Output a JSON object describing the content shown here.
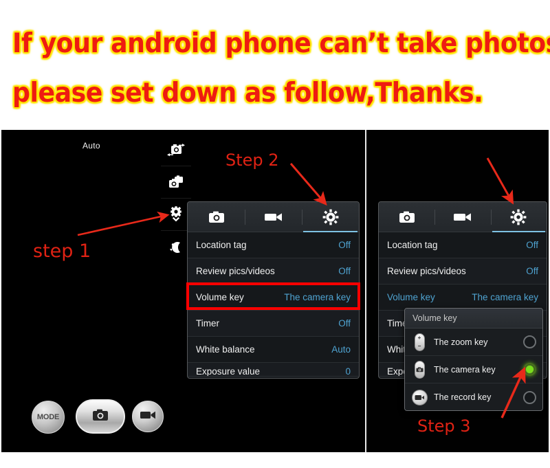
{
  "headline": {
    "line1": "If your android phone can’t take photos,",
    "line2": "please set down as follow,Thanks.",
    "text_color": "#ee1b11",
    "outline_color": "#ffe400"
  },
  "annotations": [
    {
      "id": "step-1",
      "label": "step 1",
      "color": "#e02214"
    },
    {
      "id": "step-2",
      "label": "Step 2",
      "color": "#e02214"
    },
    {
      "id": "step-3",
      "label": "Step 3",
      "color": "#e02214"
    }
  ],
  "viewfinder": {
    "mode_label": "Auto",
    "side_icons": [
      {
        "name": "switch-camera-icon"
      },
      {
        "name": "multi-shot-camera-icon"
      },
      {
        "name": "settings-gear-expand-icon"
      },
      {
        "name": "night-mode-icon"
      }
    ],
    "controls": {
      "mode_label": "MODE",
      "shutter_icon": "camera-icon",
      "record_icon": "camcorder-icon"
    }
  },
  "settings_panel": {
    "tabs": [
      {
        "name": "tab-photo",
        "icon": "camera-icon",
        "active": false
      },
      {
        "name": "tab-video",
        "icon": "camcorder-icon",
        "active": false
      },
      {
        "name": "tab-general",
        "icon": "gear-icon",
        "active": true
      }
    ],
    "active_tab_accent": "#7ec2e4",
    "value_color": "#4fa3d1",
    "highlight_border_color": "#ff0000",
    "rows": [
      {
        "label": "Location tag",
        "value": "Off"
      },
      {
        "label": "Review pics/videos",
        "value": "Off"
      },
      {
        "label": "Volume key",
        "value": "The camera key"
      },
      {
        "label": "Timer",
        "value": "Off"
      },
      {
        "label": "White balance",
        "value": "Auto"
      },
      {
        "label": "Exposure value",
        "value": "0"
      }
    ]
  },
  "dialog": {
    "title": "Volume key",
    "options": [
      {
        "label": "The zoom key",
        "icon": "volume-rocker-zoom-icon",
        "selected": false
      },
      {
        "label": "The camera key",
        "icon": "volume-rocker-camera-icon",
        "selected": true
      },
      {
        "label": "The record key",
        "icon": "record-circle-icon",
        "selected": false
      }
    ],
    "selected_color": "#7adc1e"
  }
}
